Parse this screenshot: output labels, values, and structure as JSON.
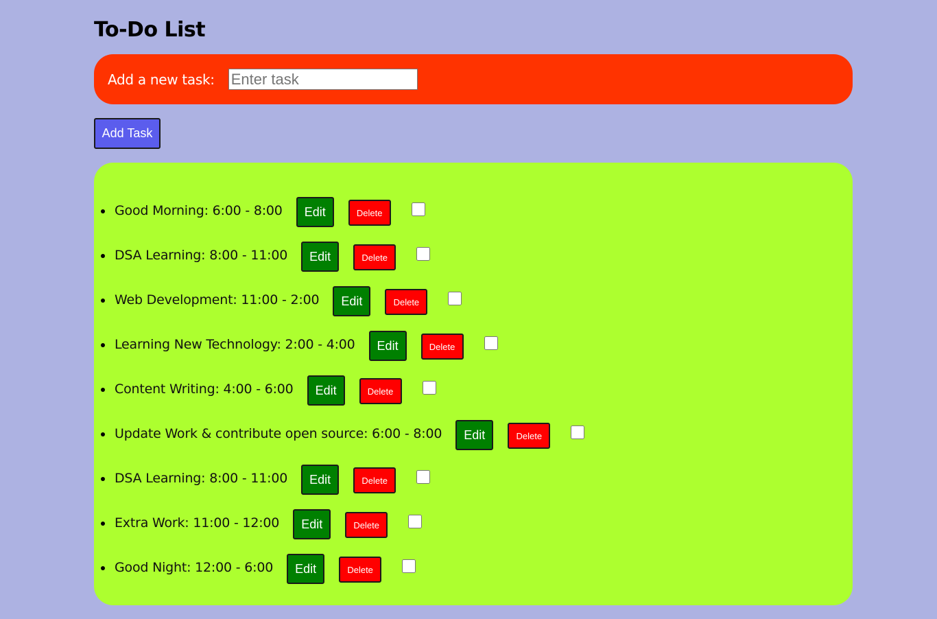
{
  "header": {
    "title": "To-Do List"
  },
  "add_form": {
    "label": "Add a new task:",
    "input_value": "",
    "input_placeholder": "Enter task",
    "add_button_label": "Add Task"
  },
  "tasks": [
    {
      "text": "Good Morning: 6:00 - 8:00",
      "edit_label": "Edit",
      "delete_label": "Delete",
      "done": false
    },
    {
      "text": "DSA Learning: 8:00 - 11:00",
      "edit_label": "Edit",
      "delete_label": "Delete",
      "done": false
    },
    {
      "text": "Web Development: 11:00 - 2:00",
      "edit_label": "Edit",
      "delete_label": "Delete",
      "done": false
    },
    {
      "text": "Learning New Technology: 2:00 - 4:00",
      "edit_label": "Edit",
      "delete_label": "Delete",
      "done": false
    },
    {
      "text": "Content Writing: 4:00 - 6:00",
      "edit_label": "Edit",
      "delete_label": "Delete",
      "done": false
    },
    {
      "text": "Update Work & contribute open source: 6:00 - 8:00",
      "edit_label": "Edit",
      "delete_label": "Delete",
      "done": false
    },
    {
      "text": "DSA Learning: 8:00 - 11:00",
      "edit_label": "Edit",
      "delete_label": "Delete",
      "done": false
    },
    {
      "text": "Extra Work: 11:00 - 12:00",
      "edit_label": "Edit",
      "delete_label": "Delete",
      "done": false
    },
    {
      "text": "Good Night: 12:00 - 6:00",
      "edit_label": "Edit",
      "delete_label": "Delete",
      "done": false
    }
  ],
  "colors": {
    "page_background": "#adb2e2",
    "add_panel_background": "#ff3300",
    "add_button_background": "#5b5ded",
    "task_panel_background": "#adff2f",
    "edit_button_background": "#008000",
    "delete_button_background": "#ff0000"
  }
}
